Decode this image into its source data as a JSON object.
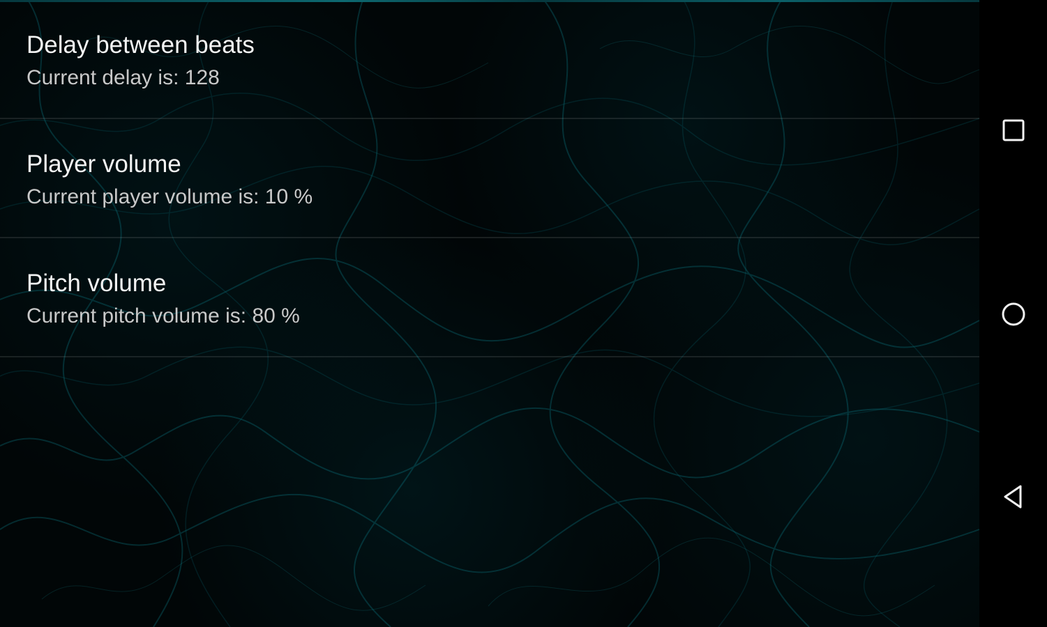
{
  "settings": {
    "items": [
      {
        "title": "Delay between beats",
        "summary": "Current delay is: 128"
      },
      {
        "title": "Player volume",
        "summary": "Current player volume is: 10 %"
      },
      {
        "title": "Pitch volume",
        "summary": "Current pitch volume is: 80 %"
      }
    ]
  },
  "navigation": {
    "buttons": [
      {
        "icon": "square-icon"
      },
      {
        "icon": "circle-icon"
      },
      {
        "icon": "triangle-back-icon"
      }
    ]
  },
  "colors": {
    "background": "#000000",
    "accent": "#0d6870",
    "title": "#f4f4f4",
    "summary": "#c9c9c9"
  }
}
